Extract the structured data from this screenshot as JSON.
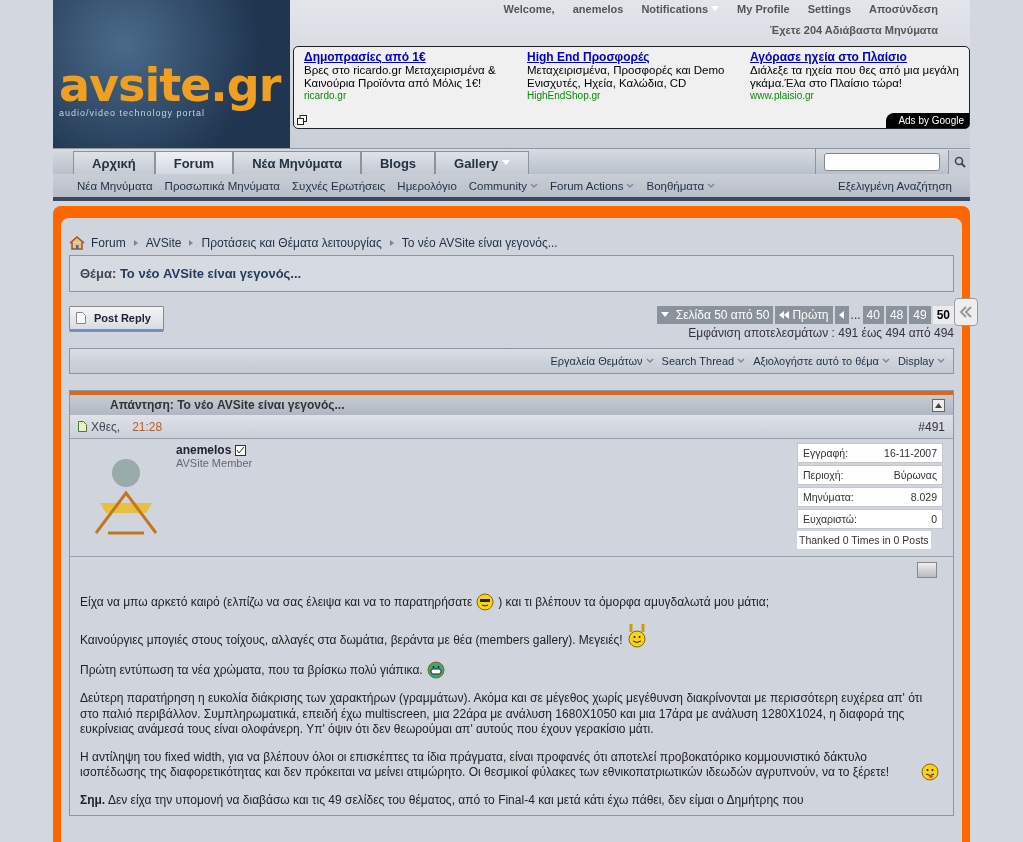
{
  "header": {
    "logo": {
      "title": "avsite.gr",
      "tagline": "audio/video technology portal"
    },
    "top_links": [
      {
        "label": "Welcome,",
        "kind": "text"
      },
      {
        "label": "anemelos",
        "kind": "text"
      },
      {
        "label": "Notifications",
        "kind": "menu"
      },
      {
        "label": "My Profile",
        "kind": "link"
      },
      {
        "label": "Settings",
        "kind": "link"
      },
      {
        "label": "Αποσύνδεση",
        "kind": "link"
      }
    ],
    "unread": "Έχετε 204 Αδιάβαστα Μηνύματα",
    "ads": [
      {
        "title": "Δημοπρασίες από 1€",
        "text": "Βρες στο ricardo.gr Μεταχειρισμένα & Καινούρια Προϊόντα από Μόλις 1€!",
        "url": "ricardo.gr"
      },
      {
        "title": "High End Προσφορές",
        "text": "Μεταχειρισμένα, Προσφορές και Demo Ενισχυτές, Ηχεία, Καλώδια, CD",
        "url": "HighEndShop.gr"
      },
      {
        "title": "Αγόρασε ηχεία στο Πλαίσιο",
        "text": "Διάλεξε τα ηχεία που θες από μια μεγάλη γκάμα.Έλα στο Πλαίσιο τώρα!",
        "url": "www.plaisio.gr"
      }
    ],
    "ads_badge": "Ads by Google"
  },
  "nav": {
    "tabs": [
      {
        "label": "Αρχική",
        "selected": false,
        "menu": false
      },
      {
        "label": "Forum",
        "selected": true,
        "menu": false
      },
      {
        "label": "Νέα Μηνύματα",
        "selected": false,
        "menu": false
      },
      {
        "label": "Blogs",
        "selected": false,
        "menu": false
      },
      {
        "label": "Gallery",
        "selected": false,
        "menu": true
      }
    ],
    "subnav": [
      {
        "label": "Νέα Μηνύματα",
        "menu": false
      },
      {
        "label": "Προσωπικά Μηνύματα",
        "menu": false
      },
      {
        "label": "Συχνές Ερωτήσεις",
        "menu": false
      },
      {
        "label": "Ημερολόγιο",
        "menu": false
      },
      {
        "label": "Community",
        "menu": true
      },
      {
        "label": "Forum Actions",
        "menu": true
      },
      {
        "label": "Βοηθήματα",
        "menu": true
      }
    ],
    "advanced_search": "Εξελιγμένη Αναζήτηση"
  },
  "breadcrumb": [
    "Forum",
    "AVSite",
    "Προτάσεις και Θέματα λειτουργίας",
    "Το νέο AVSite είναι γεγονός..."
  ],
  "thread_title": {
    "label": "Θέμα:",
    "title": "Το νέο AVSite είναι γεγονός..."
  },
  "post_reply": "Post Reply",
  "pagination": {
    "summary": "Σελίδα 50 από 50",
    "first": "Πρώτη",
    "ellipsis": "...",
    "pages": [
      {
        "label": "40",
        "selected": false
      },
      {
        "label": "48",
        "selected": false
      },
      {
        "label": "49",
        "selected": false
      },
      {
        "label": "50",
        "selected": true
      }
    ],
    "results": "Εμφάνιση αποτελεσμάτων : 491 έως 494 από 494"
  },
  "thread_tools": [
    "Εργαλεία Θεμάτων",
    "Search Thread",
    "Αξιολογήστε αυτό το θέμα",
    "Display"
  ],
  "post": {
    "title": "Απάντηση: Το νέο AVSite είναι γεγονός...",
    "date": "Χθες,",
    "time": "21:28",
    "number": "#491",
    "user": {
      "name": "anemelos",
      "role": "AVSite Member",
      "online": true
    },
    "stats": [
      {
        "label": "Εγγραφή:",
        "value": "16-11-2007"
      },
      {
        "label": "Περιοχή:",
        "value": "Βύρωνας"
      },
      {
        "label": "Μηνύματα:",
        "value": "8.029"
      },
      {
        "label": "Ευχαριστώ:",
        "value": "0"
      }
    ],
    "thanked": "Thanked 0 Times in 0 Posts",
    "paragraphs": [
      [
        {
          "kind": "text",
          "text": "Είχα να μπω αρκετό καιρό (ελπίζω να σας έλειψα και να το παρατηρήσατε"
        },
        {
          "kind": "cool"
        },
        {
          "kind": "text",
          "text": ") και τι βλέπουν τα όμορφα αμυγδαλωτά μου μάτια;"
        }
      ],
      [
        {
          "kind": "text",
          "text": "Καινούργιες μπογιές στους τοίχους, αλλαγές στα δωμάτια, βεράντα με θέα (members gallery). Μεγειές!"
        },
        {
          "kind": "wave"
        }
      ],
      [
        {
          "kind": "text",
          "text": "Πρώτη εντύπωση τα νέα χρώματα, που τα βρίσκω πολύ γιάπικα."
        },
        {
          "kind": "grin"
        }
      ],
      [
        {
          "kind": "text",
          "text": "Δεύτερη παρατήρηση η ευκολία διάκρισης των χαρακτήρων (γραμμάτων). Ακόμα και σε μέγεθος χωρίς μεγέθυνση διακρίνονται με περισσότερη ευχέρεα απ' ότι στο παλιό περιβάλλον. Συμπληρωματικά, επειδή έχω multiscreen, μια 22άρα με ανάλυση 1680X1050 και μια 17άρα με ανάλυση 1280X1024, η διαφορά της ευκρίνειας ανάμεσά τους είναι ολοφάνερη. Υπ' όψιν ότι δεν θεωρούμαι απ' αυτούς που έχουν γερακίσιο μάτι."
        }
      ],
      [
        {
          "kind": "text",
          "text": "Η αντίληψη του fixed width, για να βλέπουν όλοι οι επισκέπτες τα ίδια πράγματα, είναι προφανές ότι αποτελεί προβοκατόρικο κομμουνιστικό δάκτυλο ισοπέδωσης της διαφορετικότητας και δεν πρόκειται να μείνει ατιμώρητο. Οι θεσμικοί φύλακες των εθνικοπατριωτικών ιδεωδών αγρυπνούν, να το ξέρετε!"
        },
        {
          "kind": "tongue"
        }
      ],
      [
        {
          "kind": "text",
          "text": "**Σημ.** Δεν είχα την υπομονή να διαβάσω και τις 49 σελίδες του θέματος, από το Final-4 και μετά κάτι έχω πάθει, δεν είμαι ο Δημήτρης που"
        }
      ]
    ]
  }
}
